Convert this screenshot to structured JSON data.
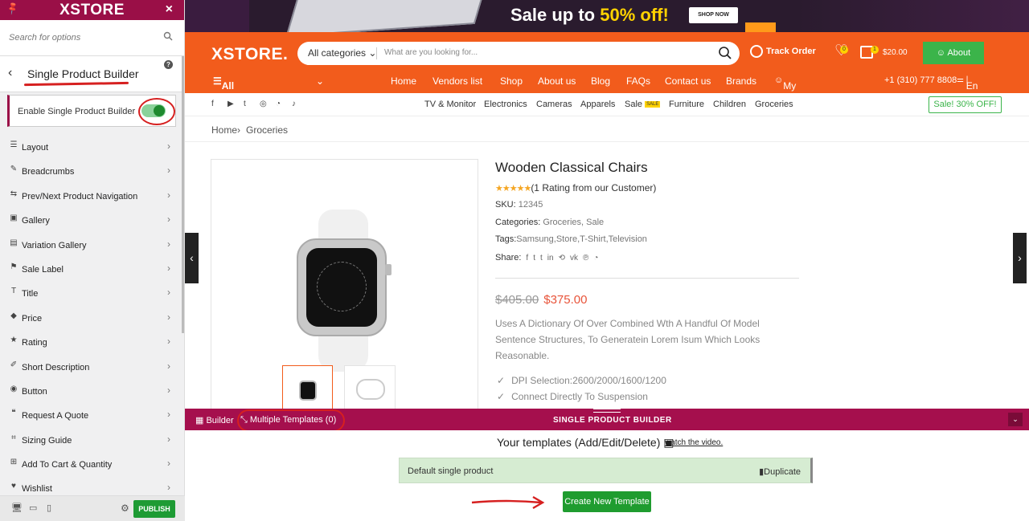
{
  "colors": {
    "brand": "#9a0f47",
    "orange": "#f25c1c",
    "green": "#1f9c2f",
    "annotation_red": "#d62020"
  },
  "sidebar": {
    "logo": "XSTORE",
    "search_placeholder": "Search for options",
    "section_title": "Single Product Builder",
    "enable_label": "Enable Single Product Builder",
    "enabled": true,
    "items": [
      {
        "label": "Layout",
        "icon": "layout-icon"
      },
      {
        "label": "Breadcrumbs",
        "icon": "brush-icon"
      },
      {
        "label": "Prev/Next Product Navigation",
        "icon": "navigation-icon"
      },
      {
        "label": "Gallery",
        "icon": "gallery-icon"
      },
      {
        "label": "Variation Gallery",
        "icon": "variation-gallery-icon"
      },
      {
        "label": "Sale Label",
        "icon": "tag-icon"
      },
      {
        "label": "Title",
        "icon": "title-icon"
      },
      {
        "label": "Price",
        "icon": "price-tag-icon"
      },
      {
        "label": "Rating",
        "icon": "star-icon"
      },
      {
        "label": "Short Description",
        "icon": "edit-icon"
      },
      {
        "label": "Button",
        "icon": "button-icon"
      },
      {
        "label": "Request A Quote",
        "icon": "quote-icon"
      },
      {
        "label": "Sizing Guide",
        "icon": "ruler-icon"
      },
      {
        "label": "Add To Cart & Quantity",
        "icon": "cart-icon"
      },
      {
        "label": "Wishlist",
        "icon": "heart-icon"
      }
    ],
    "publish_label": "PUBLISH"
  },
  "banner": {
    "sale_text": "Sale up to",
    "sale_pct": "50% off!",
    "shop_now": "SHOP NOW"
  },
  "header": {
    "logo": "XSTORE.",
    "category_select": "All categories",
    "search_placeholder": "What are you looking for...",
    "track_order": "Track Order",
    "wishlist_count": "0",
    "cart_count": "1",
    "cart_amount": "$20.00",
    "about": "About",
    "departments": "All Departments",
    "nav": [
      "Home",
      "Vendors list",
      "Shop",
      "About us",
      "Blog",
      "FAQs",
      "Contact us",
      "Brands"
    ],
    "account": "My account",
    "phone": "+1 (310) 777 8808",
    "lang": "En"
  },
  "categories": [
    "TV & Monitor",
    "Electronics",
    "Cameras",
    "Apparels",
    "Sale",
    "Furniture",
    "Children",
    "Groceries"
  ],
  "sale_badge": "SALE",
  "sale_off": "Sale! 30% OFF!",
  "breadcrumb": {
    "home": "Home",
    "sep": "›",
    "current": "Groceries"
  },
  "product": {
    "title": "Wooden Classical Chairs",
    "rating_text": "(1 Rating from our Customer)",
    "sku_label": "SKU:",
    "sku": "12345",
    "categories_label": "Categories:",
    "categories": "Groceries,  Sale",
    "tags_label": "Tags:",
    "tags": "Samsung,Store,T-Shirt,Television",
    "share_label": "Share:",
    "old_price": "$405.00",
    "price": "$375.00",
    "description": "Uses A Dictionary Of Over Combined Wth A Handful Of Model Sentence Structures, To Generatein Lorem Isum Which Looks Reasonable.",
    "features": [
      "DPI Selection:2600/2000/1600/1200",
      "Connect Directly To Suspension"
    ]
  },
  "builder_bar": {
    "builder": "Builder",
    "multiple": "Multiple Templates (0)",
    "title": "SINGLE PRODUCT BUILDER"
  },
  "templates": {
    "heading": "Your templates (Add/Edit/Delete)",
    "watch": "watch the video.",
    "default_name": "Default single product",
    "duplicate": "Duplicate",
    "create": "Create New Template"
  }
}
